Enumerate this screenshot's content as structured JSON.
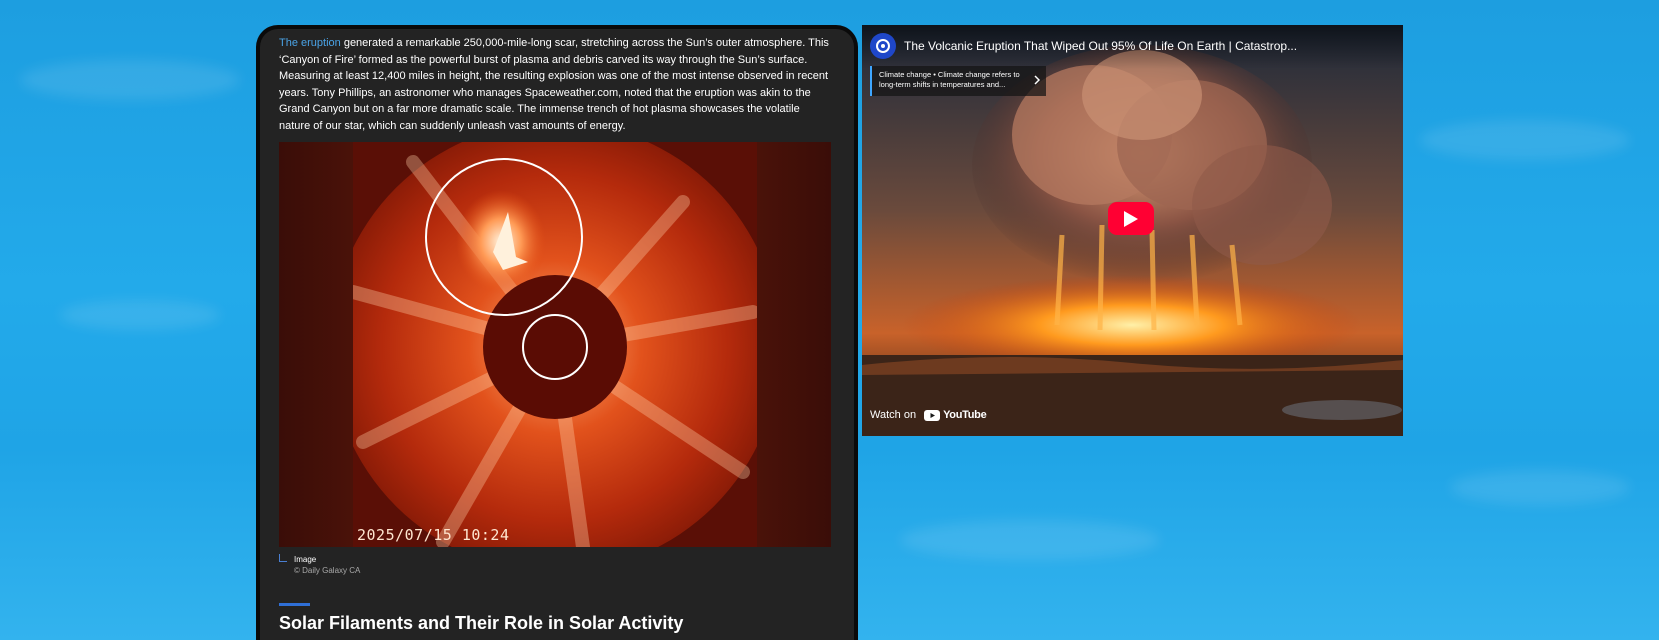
{
  "article": {
    "paragraph": {
      "link_text": "The eruption",
      "body": " generated a remarkable 250,000-mile-long scar, stretching across the Sun’s outer atmosphere. This ‘Canyon of Fire’ formed as the powerful burst of plasma and debris carved its way through the Sun’s surface. Measuring at least 12,400 miles in height, the resulting explosion was one of the most intense observed in recent years. Tony Phillips, an astronomer who manages Spaceweather.com, noted that the eruption was akin to the Grand Canyon but on a far more dramatic scale. The immense trench of hot plasma showcases the volatile nature of our star, which can suddenly unleash vast amounts of energy."
    },
    "figure": {
      "timestamp": "2025/07/15  10:24",
      "caption_title": "Image",
      "caption_credit": "© Daily Galaxy CA"
    },
    "section_heading": "Solar Filaments and Their Role in Solar Activity"
  },
  "video": {
    "title": "The Volcanic Eruption That Wiped Out 95% Of Life On Earth | Catastrop...",
    "info_chip": "Climate change • Climate change refers to long-term shifts in temperatures and...",
    "watch_on": "Watch on",
    "platform": "YouTube",
    "icons": {
      "channel": "channel-logo-icon",
      "chip": "chevron-right-icon",
      "play": "play-icon",
      "logo": "youtube-logo-icon"
    },
    "colors": {
      "play_button": "#ff0033",
      "chip_accent": "#3ea6ff"
    }
  },
  "colors": {
    "link": "#4aa3e6",
    "accent_bar": "#2f6fd6",
    "card_bg": "#232323"
  }
}
